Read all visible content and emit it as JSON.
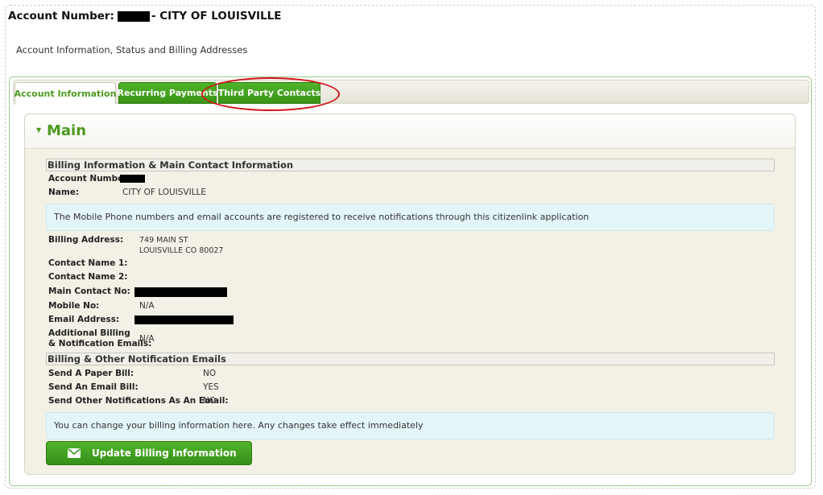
{
  "header": {
    "account_prefix": "Account Number:",
    "account_suffix": "- CITY OF LOUISVILLE",
    "subtitle": "Account Information, Status and Billing Addresses"
  },
  "tabs": [
    {
      "label": "Account Information",
      "active": true
    },
    {
      "label": "Recurring Payments",
      "active": false
    },
    {
      "label": "Third Party Contacts",
      "active": false
    }
  ],
  "main": {
    "title": "Main",
    "billing_section": {
      "heading": "Billing Information & Main Contact Information",
      "account_number_label": "Account Number:",
      "name_label": "Name:",
      "name_value": "CITY OF LOUISVILLE",
      "notice": "The Mobile Phone numbers and email accounts are registered to receive notifications through this citizenlink application",
      "billing_address_label": "Billing Address:",
      "billing_address_line1": "749 MAIN ST",
      "billing_address_line2": "LOUISVILLE CO 80027",
      "contact_name_1_label": "Contact Name 1:",
      "contact_name_2_label": "Contact Name 2:",
      "main_contact_label": "Main Contact No:",
      "mobile_label": "Mobile No:",
      "mobile_value": "N/A",
      "email_label": "Email Address:",
      "additional_label_1": "Additional Billing",
      "additional_label_2": "& Notification Emails:",
      "additional_value": "N/A"
    },
    "notification_section": {
      "heading": "Billing & Other Notification Emails",
      "paper_bill_label": "Send A Paper Bill:",
      "paper_bill_value": "NO",
      "email_bill_label": "Send An Email Bill:",
      "email_bill_value": "YES",
      "other_label": "Send Other Notifications As An Email:",
      "other_value": "NO",
      "notice": "You can change your billing information here. Any changes take effect immediately"
    },
    "update_button": "Update Billing Information"
  },
  "colors": {
    "accent_green": "#4c9a1f",
    "button_green": "#3a9417",
    "highlight_red": "#d4141b",
    "info_bg": "#e4f5f8"
  }
}
